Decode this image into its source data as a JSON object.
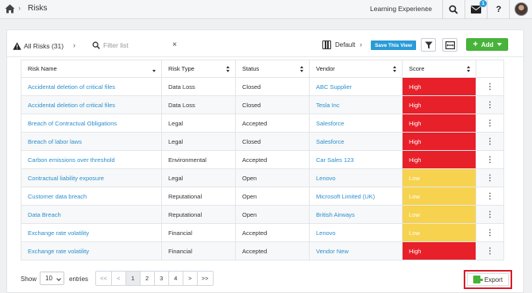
{
  "header": {
    "breadcrumb": "Risks",
    "project": "Learning Experience",
    "notification_count": "1"
  },
  "toolbar": {
    "filter_label": "All Risks (31)",
    "search_placeholder": "Filter list",
    "search_value": "",
    "view_name": "Default",
    "save_view_label": "Save This View",
    "add_label": "Add"
  },
  "table": {
    "columns": [
      "Risk Name",
      "Risk Type",
      "Status",
      "Vendor",
      "Score"
    ],
    "rows": [
      {
        "name": "Accidental deletion of critical files",
        "type": "Data Loss",
        "status": "Closed",
        "vendor": "ABC Supplier",
        "score": "High"
      },
      {
        "name": "Accidental deletion of critical files",
        "type": "Data Loss",
        "status": "Closed",
        "vendor": "Tesla Inc",
        "score": "High"
      },
      {
        "name": "Breach of Contractual Obligations",
        "type": "Legal",
        "status": "Accepted",
        "vendor": "Salesforce",
        "score": "High"
      },
      {
        "name": "Breach of labor laws",
        "type": "Legal",
        "status": "Closed",
        "vendor": "Salesforce",
        "score": "High"
      },
      {
        "name": "Carbon emissions over threshold",
        "type": "Environmental",
        "status": "Accepted",
        "vendor": "Car Sales 123",
        "score": "High"
      },
      {
        "name": "Contractual liability exposure",
        "type": "Legal",
        "status": "Open",
        "vendor": "Lenovo",
        "score": "Low"
      },
      {
        "name": "Customer data breach",
        "type": "Reputational",
        "status": "Open",
        "vendor": "Microsoft Limited (UK)",
        "score": "Low"
      },
      {
        "name": "Data Breach",
        "type": "Reputational",
        "status": "Open",
        "vendor": "British Airways",
        "score": "Low"
      },
      {
        "name": "Exchange rate volatility",
        "type": "Financial",
        "status": "Accepted",
        "vendor": "Lenovo",
        "score": "Low"
      },
      {
        "name": "Exchange rate volatility",
        "type": "Financial",
        "status": "Accepted",
        "vendor": "Vendor New",
        "score": "High"
      }
    ]
  },
  "footer": {
    "show_label": "Show",
    "page_size": "10",
    "entries_label": "entries",
    "pager": [
      "<<",
      "<",
      "1",
      "2",
      "3",
      "4",
      ">",
      ">>"
    ],
    "export_label": "Export"
  },
  "colors": {
    "high": "#e8202a",
    "low": "#f6d24e",
    "link": "#2b8fcf",
    "add": "#47b33a",
    "save_view": "#2b9bd8",
    "highlight_border": "#d81c2a"
  }
}
